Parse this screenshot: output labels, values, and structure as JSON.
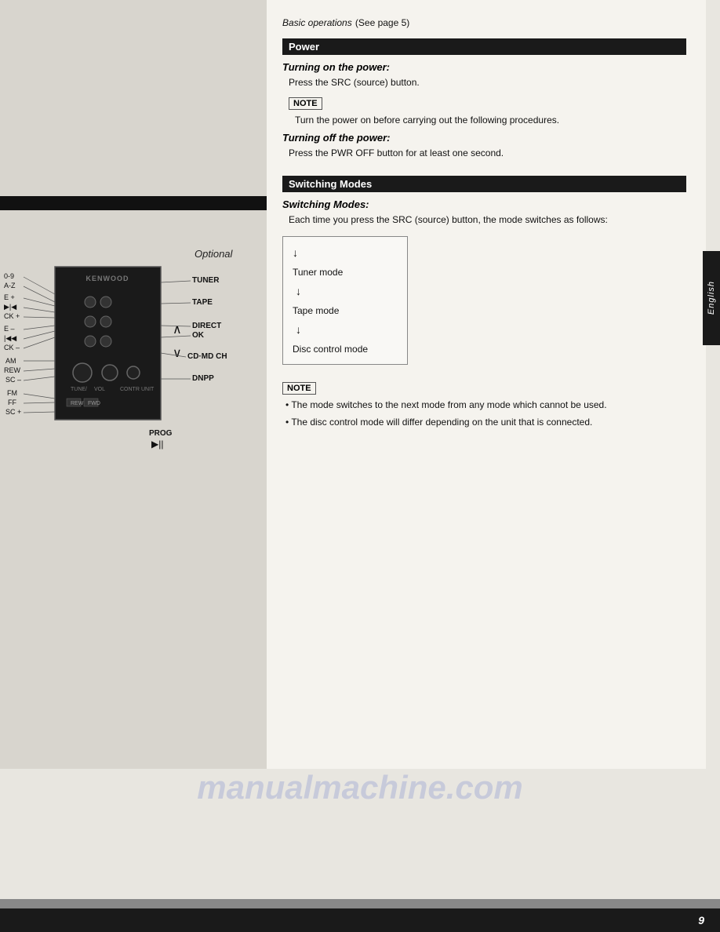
{
  "page": {
    "number": "9",
    "background_color": "#e8e6e0"
  },
  "optional_label": "Optional",
  "english_tab": "English",
  "diagram": {
    "brand": "KENWOOD",
    "left_labels": [
      "0-9",
      "A-Z",
      "E +",
      "▶|◀",
      "CK +",
      "E –",
      "|◀◀",
      "CK –",
      "AM",
      "REW",
      "SC –",
      "FM",
      "FF",
      "SC +"
    ],
    "right_labels": [
      "TUNER",
      "TAPE",
      "DIRECT",
      "OK",
      "CD·MD CH",
      "DNPP"
    ],
    "bottom_labels": [
      "PROG",
      "▶||"
    ]
  },
  "basic_operations": {
    "title": "Basic operations",
    "subtitle": "(See page 5)",
    "power_section": {
      "header": "Power",
      "turning_on": {
        "title": "Turning on the power:",
        "body": "Press the SRC (source) button."
      },
      "note1": {
        "label": "NOTE",
        "text": "Turn the power on before carrying out the following procedures."
      },
      "turning_off": {
        "title": "Turning off the power:",
        "body": "Press the PWR OFF button for at least one second."
      }
    },
    "switching_modes_section": {
      "header": "Switching Modes",
      "title": "Switching Modes:",
      "intro": "Each time you press the SRC (source) button, the mode switches as follows:",
      "modes": [
        "Tuner mode",
        "Tape mode",
        "Disc control mode"
      ],
      "note2": {
        "label": "NOTE",
        "bullets": [
          "The mode switches to the next mode from any mode which cannot be used.",
          "The disc control mode will differ depending on the unit that is connected."
        ]
      }
    }
  },
  "watermark": "manualmachine.com"
}
